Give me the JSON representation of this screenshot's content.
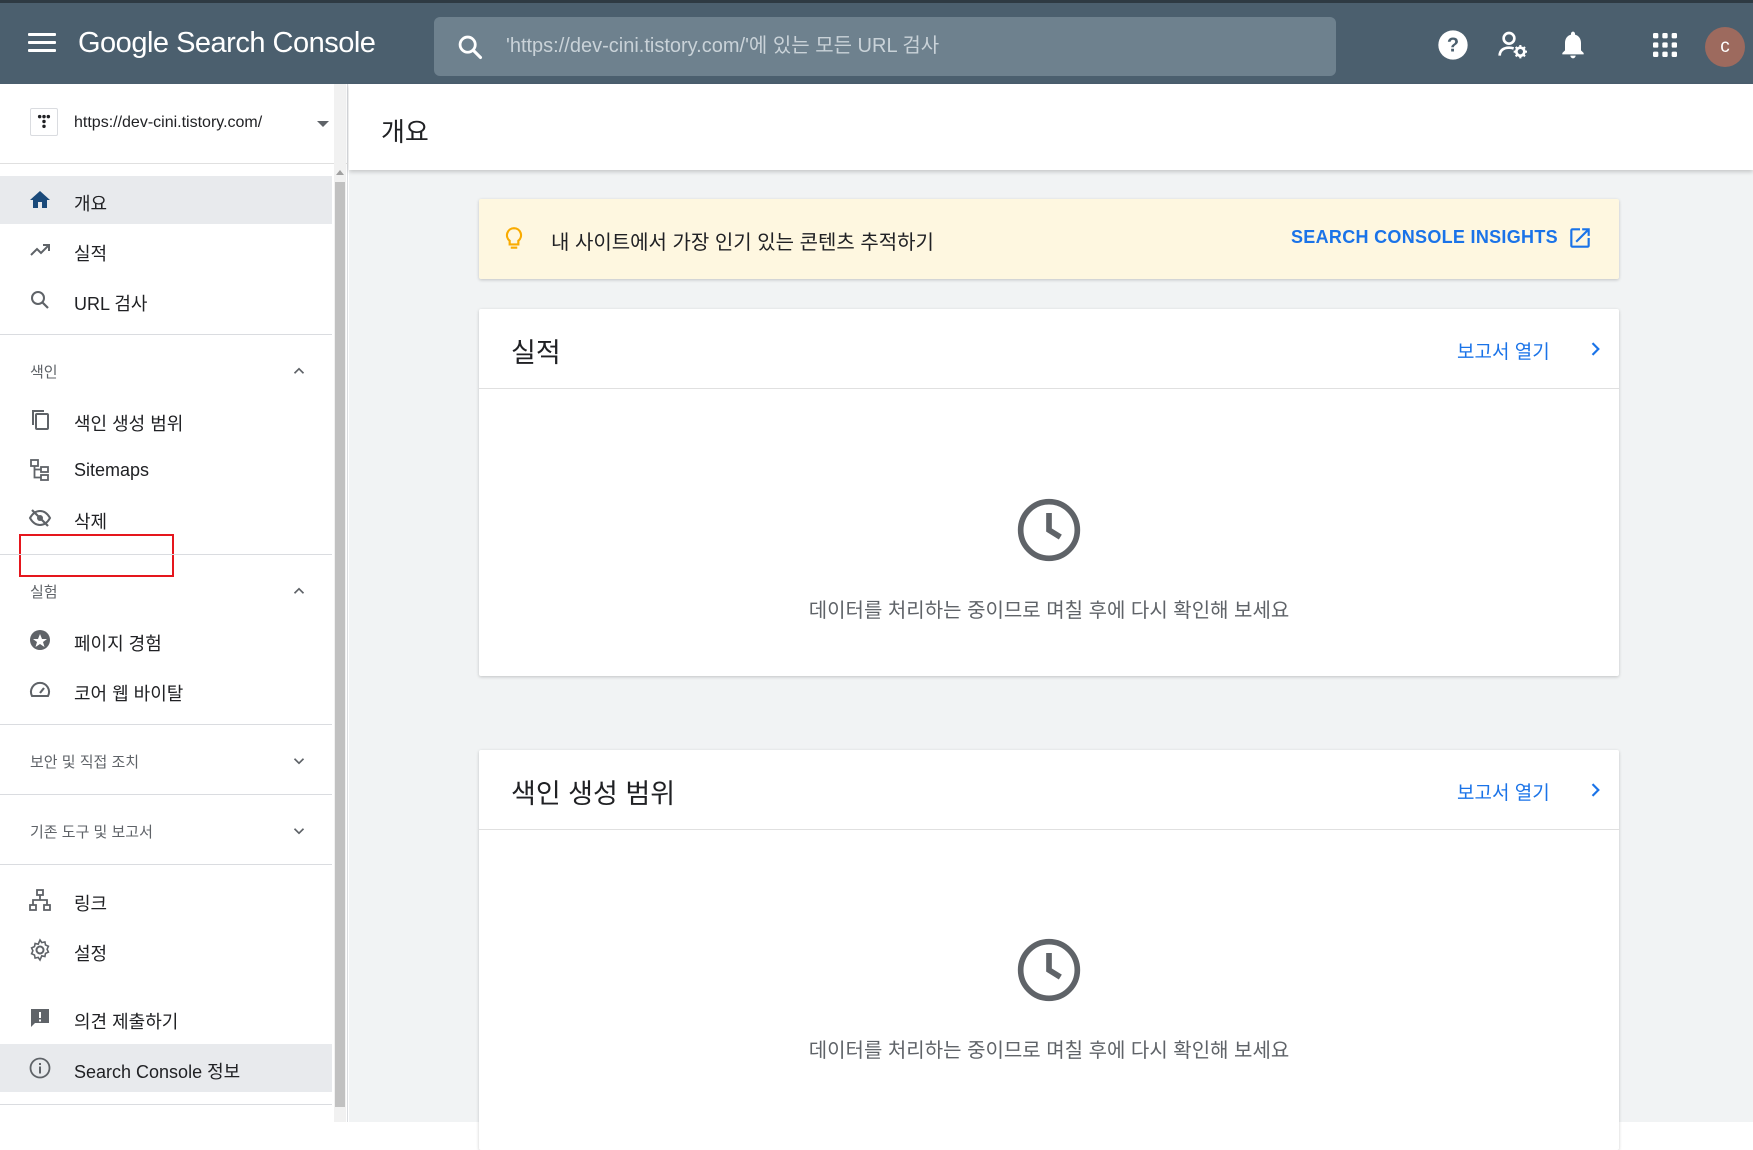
{
  "topbar": {
    "brand": "Google Search Console",
    "search_placeholder": "'https://dev-cini.tistory.com/'에 있는 모든 URL 검사",
    "avatar_letter": "c",
    "colors": {
      "bar": "#4b5f6e",
      "search": "#6e818e",
      "avatar": "#9d6a5e"
    }
  },
  "sidebar": {
    "property_url": "https://dev-cini.tistory.com/",
    "items_top": [
      {
        "label": "개요",
        "icon": "home-icon"
      },
      {
        "label": "실적",
        "icon": "trending-up-icon"
      },
      {
        "label": "URL 검사",
        "icon": "search-icon"
      }
    ],
    "section_index": {
      "label": "색인",
      "items": [
        {
          "label": "색인 생성 범위",
          "icon": "copy-icon"
        },
        {
          "label": "Sitemaps",
          "icon": "sitemap-icon"
        },
        {
          "label": "삭제",
          "icon": "visibility-off-icon"
        }
      ]
    },
    "section_experience": {
      "label": "실험",
      "items": [
        {
          "label": "페이지 경험",
          "icon": "plus-circle-icon"
        },
        {
          "label": "코어 웹 바이탈",
          "icon": "speed-icon"
        }
      ]
    },
    "section_security": {
      "label": "보안 및 직접 조치"
    },
    "section_legacy": {
      "label": "기존 도구 및 보고서"
    },
    "items_bottom": [
      {
        "label": "링크",
        "icon": "links-icon"
      },
      {
        "label": "설정",
        "icon": "gear-icon"
      },
      {
        "label": "의견 제출하기",
        "icon": "feedback-icon"
      },
      {
        "label": "Search Console 정보",
        "icon": "info-icon"
      }
    ]
  },
  "main": {
    "page_title": "개요",
    "insight": {
      "text": "내 사이트에서 가장 인기 있는 콘텐츠 추적하기",
      "link": "SEARCH CONSOLE INSIGHTS"
    },
    "cards": [
      {
        "title": "실적",
        "link": "보고서 열기",
        "message": "데이터를 처리하는 중이므로 며칠 후에 다시 확인해 보세요"
      },
      {
        "title": "색인 생성 범위",
        "link": "보고서 열기",
        "message": "데이터를 처리하는 중이므로 며칠 후에 다시 확인해 보세요"
      }
    ]
  }
}
